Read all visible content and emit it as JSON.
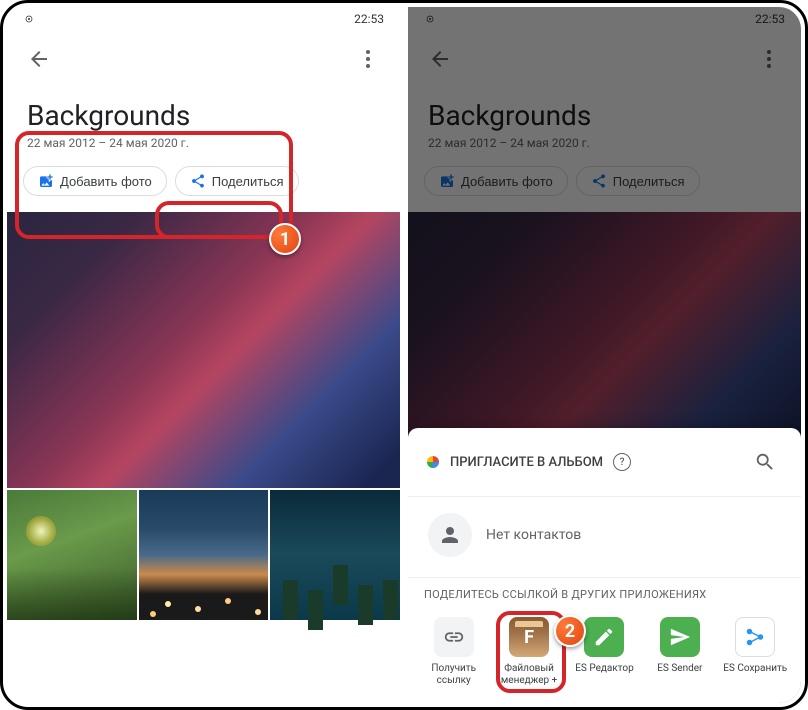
{
  "status": {
    "time": "22:53"
  },
  "album": {
    "title": "Backgrounds",
    "date_range": "22 мая 2012 – 24 мая 2020 г."
  },
  "actions": {
    "add_photo": "Добавить фото",
    "share": "Поделиться"
  },
  "share_sheet": {
    "invite_title": "ПРИГЛАСИТЕ В АЛЬБОМ",
    "no_contacts": "Нет контактов",
    "other_apps_label": "ПОДЕЛИТЕСЬ ССЫЛКОЙ В ДРУГИХ ПРИЛОЖЕНИЯХ",
    "apps": {
      "get_link": "Получить ссылку",
      "file_manager": "Файловый менеджер +",
      "es_editor": "ES Редактор",
      "es_sender": "ES Sender",
      "es_save": "ES Сохранить"
    }
  },
  "callouts": {
    "one": "1",
    "two": "2"
  }
}
